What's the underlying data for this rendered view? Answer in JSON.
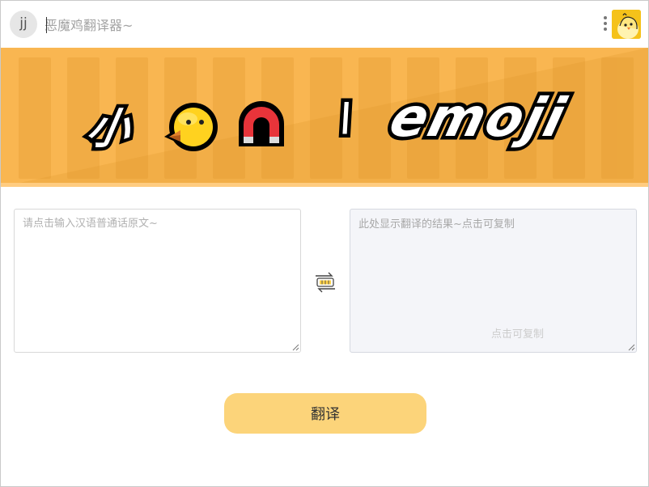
{
  "header": {
    "avatar_text": "jj",
    "title_placeholder": "恶魔鸡翻译器~",
    "menu_icon": "kebab-menu-icon",
    "mascot_icon": "chick-mascot-icon"
  },
  "banner": {
    "text_xiao": "小",
    "icon_chick": "baby-chick-emoji",
    "icon_magnet": "magnet-emoji",
    "text_slash": "\\",
    "text_emoji": "emoji",
    "colors": {
      "base": "#f1ad45",
      "stripe": "#ffc466",
      "outline": "#000000"
    }
  },
  "source": {
    "placeholder": "请点击输入汉语普通话原文~"
  },
  "result": {
    "placeholder": "此处显示翻译的结果~点击可复制",
    "copy_hint": "点击可复制"
  },
  "swap_icon": "swap-arrows-icon",
  "translate_button": {
    "label": "翻译",
    "color": "#fcd47a"
  }
}
